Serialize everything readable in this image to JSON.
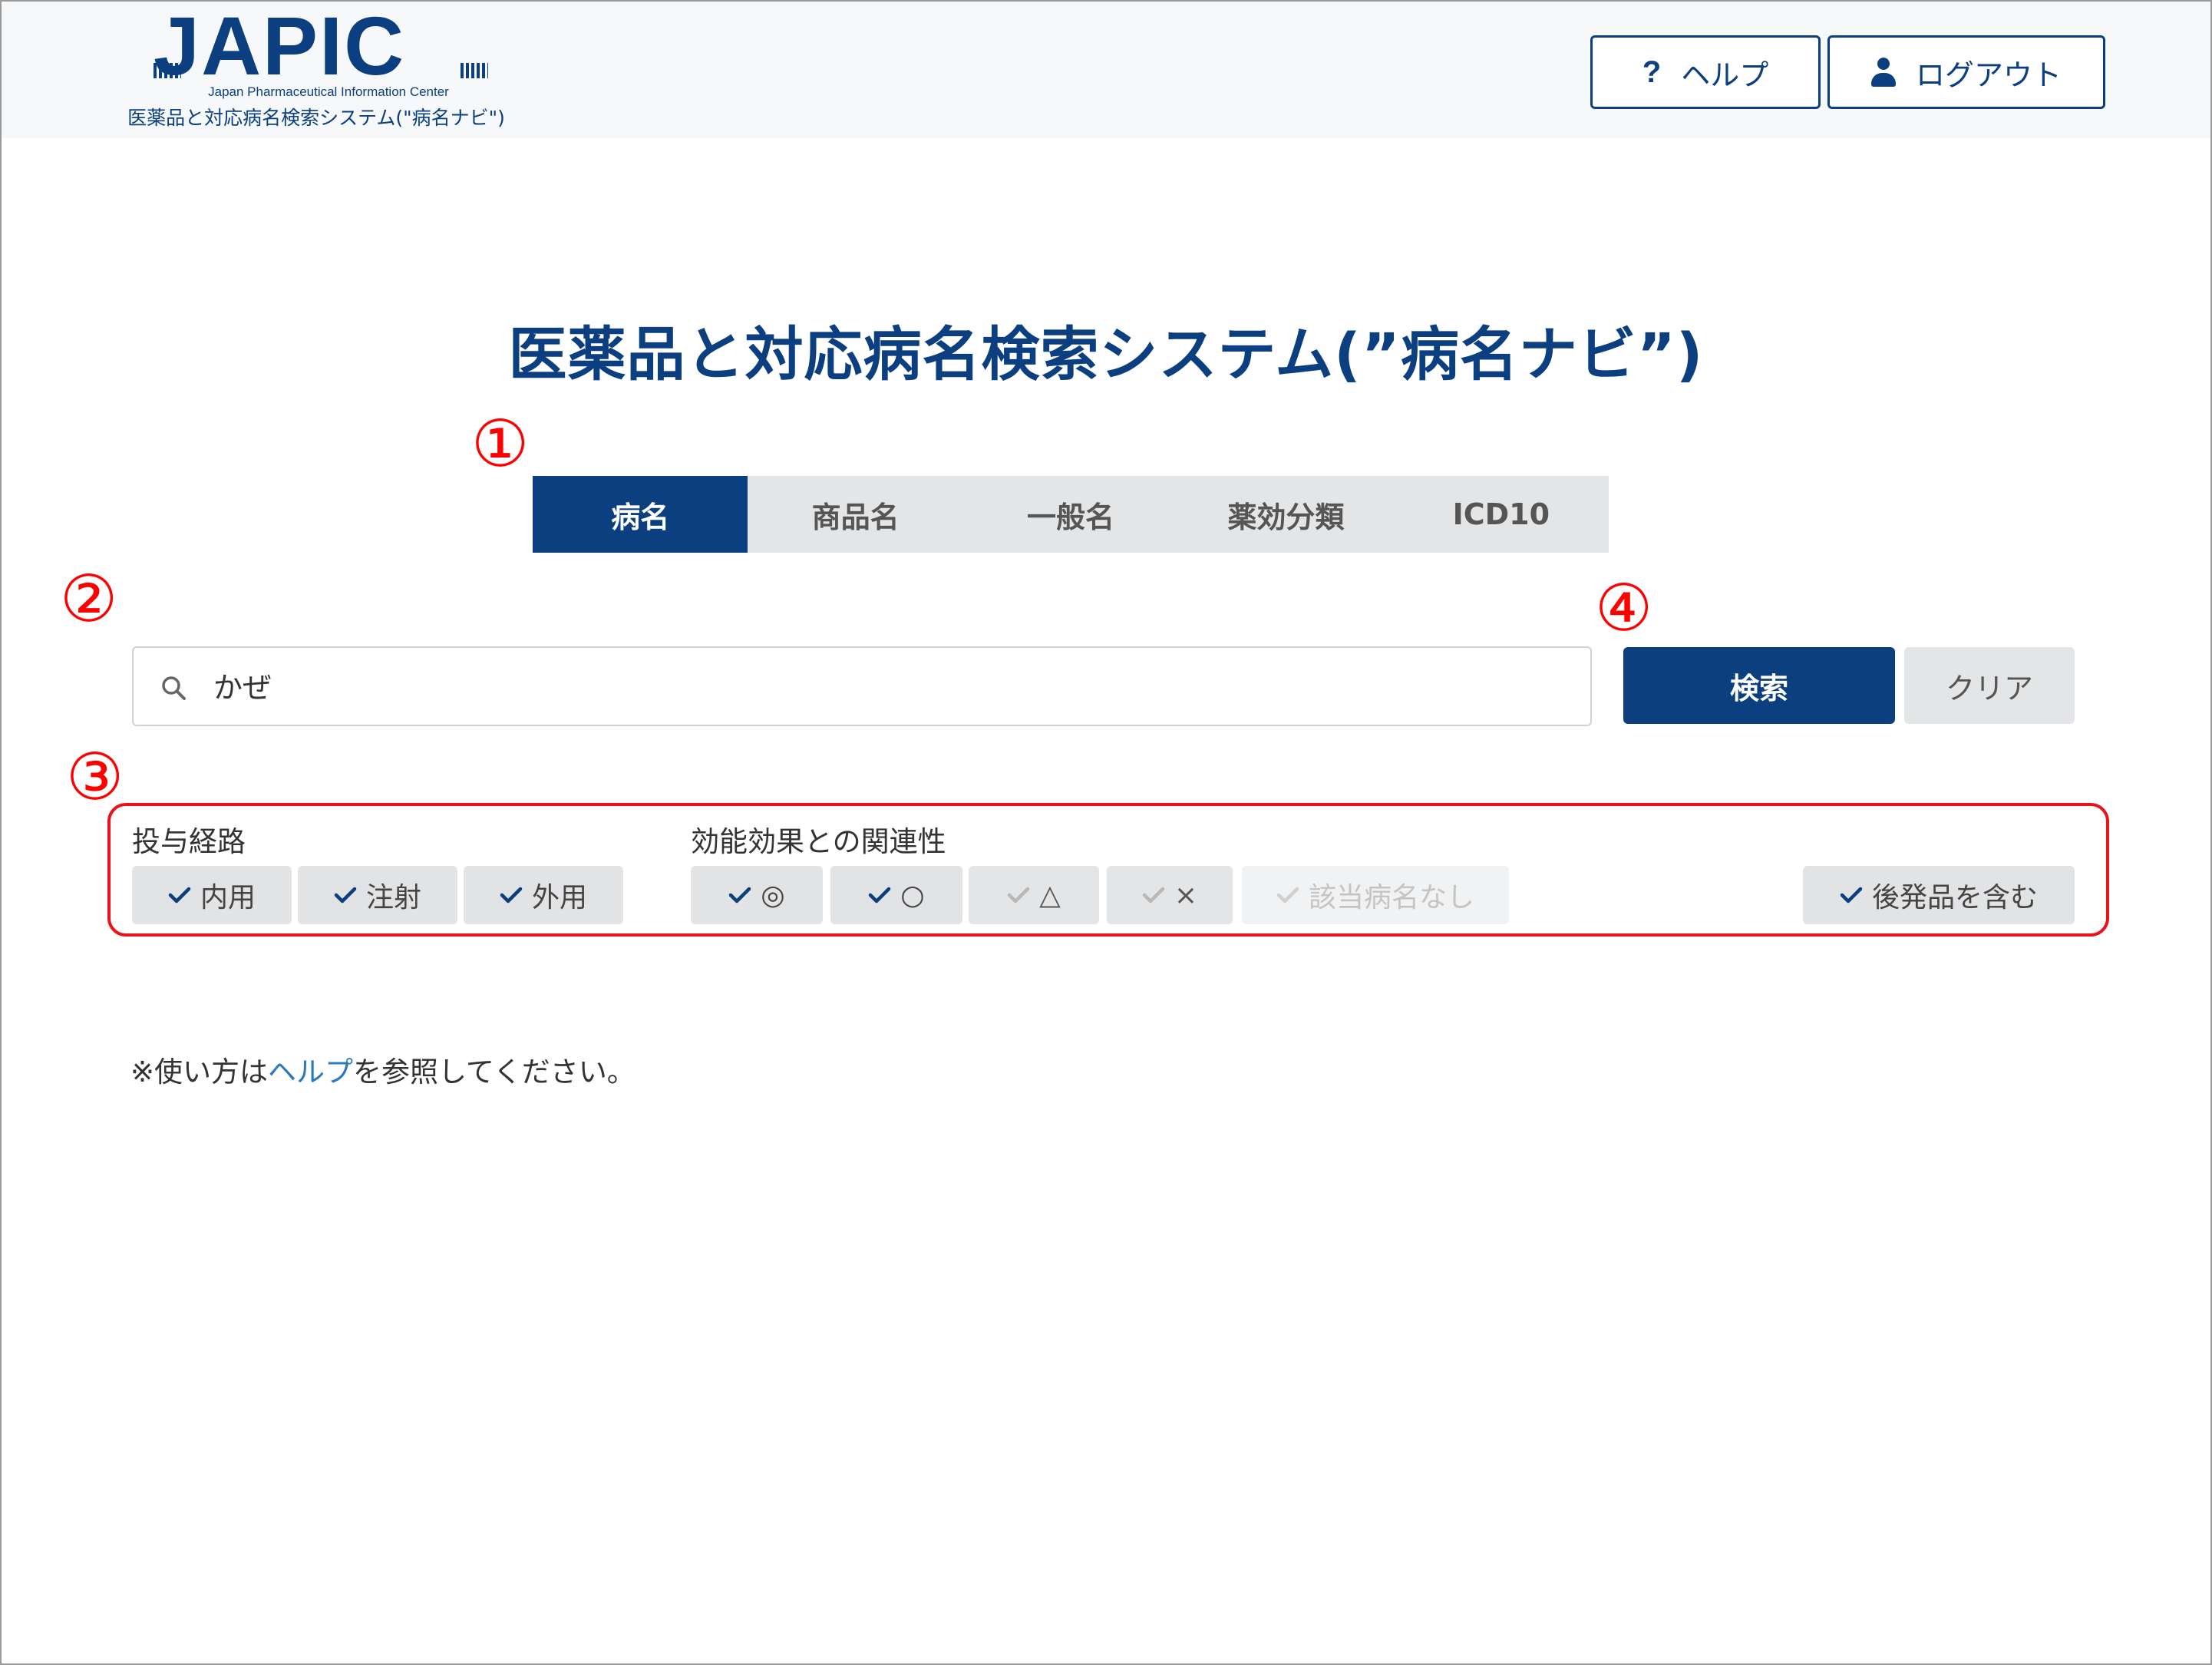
{
  "header": {
    "logo": {
      "text": "JAPIC",
      "subtitle": "Japan Pharmaceutical Information Center",
      "tagline": "医薬品と対応病名検索システム(\"病名ナビ\")"
    },
    "help_label": "ヘルプ",
    "logout_label": "ログアウト"
  },
  "title": "医薬品と対応病名検索システム(”病名ナビ”)",
  "markers": [
    "①",
    "②",
    "③",
    "④"
  ],
  "tabs": [
    {
      "label": "病名",
      "active": true
    },
    {
      "label": "商品名",
      "active": false
    },
    {
      "label": "一般名",
      "active": false
    },
    {
      "label": "薬効分類",
      "active": false
    },
    {
      "label": "ICD10",
      "active": false
    }
  ],
  "search": {
    "value": "かぜ",
    "search_label": "検索",
    "clear_label": "クリア"
  },
  "filters": {
    "route_label": "投与経路",
    "route_options": [
      {
        "label": "内用",
        "checked": true
      },
      {
        "label": "注射",
        "checked": true
      },
      {
        "label": "外用",
        "checked": true
      }
    ],
    "relevance_label": "効能効果との関連性",
    "relevance_options": [
      {
        "label": "◎",
        "checked": true
      },
      {
        "label": "○",
        "checked": true
      },
      {
        "label": "△",
        "checked": false
      },
      {
        "label": "×",
        "checked": false
      },
      {
        "label": "該当病名なし",
        "checked": false
      }
    ],
    "generic_label": "後発品を含む",
    "generic_checked": true
  },
  "note": {
    "prefix": "※使い方は",
    "link": "ヘルプ",
    "suffix": "を参照してください。"
  },
  "colors": {
    "brand": "#0b3f80",
    "annotation": "#e8141b",
    "link": "#2a78c2"
  }
}
